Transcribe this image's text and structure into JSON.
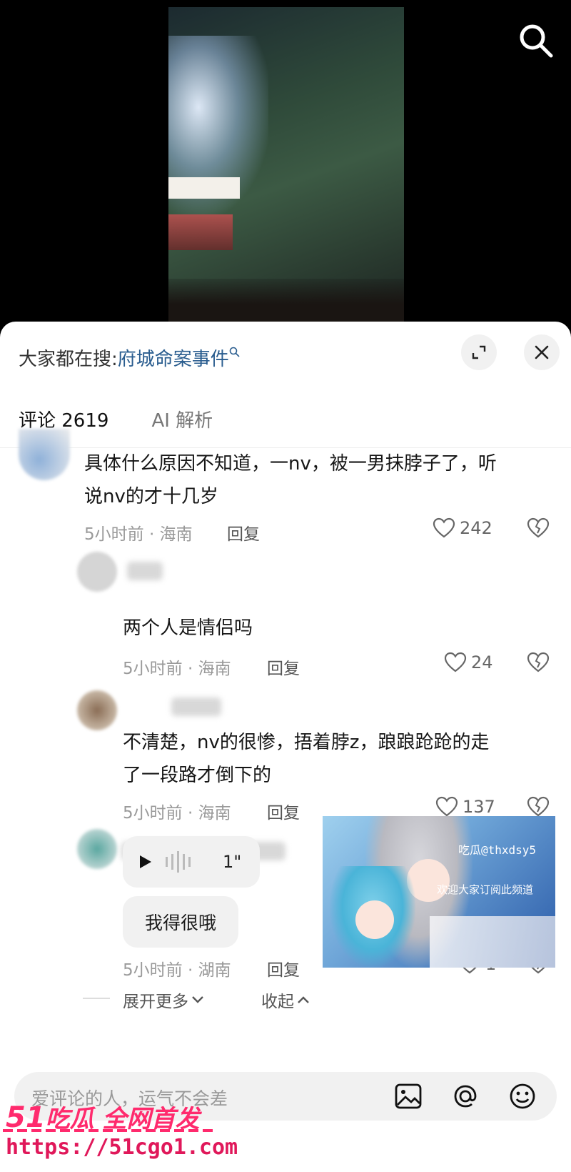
{
  "search_bar": {
    "prefix": "大家都在搜:",
    "term": "府城命案事件"
  },
  "tabs": [
    {
      "label": "评论 2619",
      "active": true
    },
    {
      "label": "AI 解析",
      "active": false
    }
  ],
  "comments": [
    {
      "lines": [
        "具体什么原因不知道，一nv，被一男抹脖子了，听",
        "说nv的才十几岁"
      ],
      "meta": "5小时前 · 海南",
      "reply": "回复",
      "likes": "242"
    },
    {
      "lines": [
        "两个人是情侣吗"
      ],
      "meta": "5小时前 · 海南",
      "reply": "回复",
      "likes": "24"
    },
    {
      "lines": [
        "不清楚，nv的很惨，捂着脖z，踉踉跄跄的走",
        "了一段路才倒下的"
      ],
      "meta": "5小时前 · 海南",
      "reply": "回复",
      "likes": "137"
    },
    {
      "voice_duration": "1\"",
      "text": "我得很哦",
      "meta": "5小时前 · 湖南",
      "reply": "回复",
      "likes": "1"
    }
  ],
  "expand_more": "展开更多",
  "collapse": "收起",
  "input": {
    "placeholder": "爱评论的人，运气不会差"
  },
  "overlay": {
    "line1": "吃瓜@thxdsy5",
    "line2": "欢迎大家订阅此频道"
  },
  "watermark": {
    "brand_num": "51",
    "brand_text": "吃瓜 全网首发",
    "url": "https://51cgo1.com"
  },
  "colors": {
    "link": "#2a5d8f",
    "watermark": "#ff2a6d"
  },
  "icons": [
    "search-icon",
    "expand-icon",
    "close-icon",
    "heart-icon",
    "broken-heart-icon",
    "play-icon",
    "chevron-down-icon",
    "chevron-up-icon",
    "image-icon",
    "at-icon",
    "emoji-icon"
  ]
}
